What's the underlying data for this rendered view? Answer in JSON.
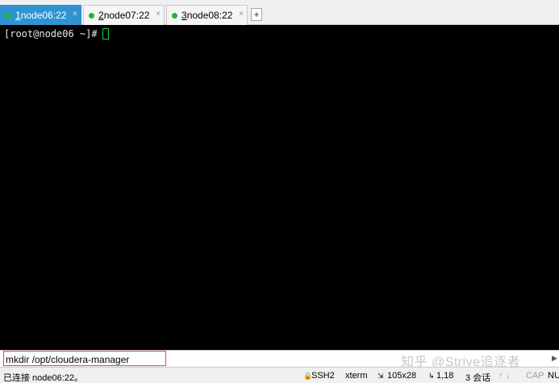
{
  "tabs": [
    {
      "number": "1",
      "label": " node06:22",
      "close": "×"
    },
    {
      "number": "2",
      "label": " node07:22",
      "close": "×"
    },
    {
      "number": "3",
      "label": " node08:22",
      "close": "×"
    }
  ],
  "tab_add": "+",
  "terminal": {
    "prompt": "[root@node06 ~]#"
  },
  "compose": {
    "value": "mkdir /opt/cloudera-manager"
  },
  "watermark": "知乎 @Strive追逐者",
  "status": {
    "connection": "已连接 node06:22。",
    "protocol": "SSH2",
    "term_type": "xterm",
    "size": "105x28",
    "cursor_pos": "1,18",
    "sessions": "3 会话",
    "arrows": "↑ ↓",
    "caps": "CAP",
    "num": "NU"
  },
  "colors": {
    "active_tab": "#2f93d1",
    "connected_dot": "#1fb534",
    "cursor": "#18d23a",
    "highlight_box": "#e04848"
  }
}
